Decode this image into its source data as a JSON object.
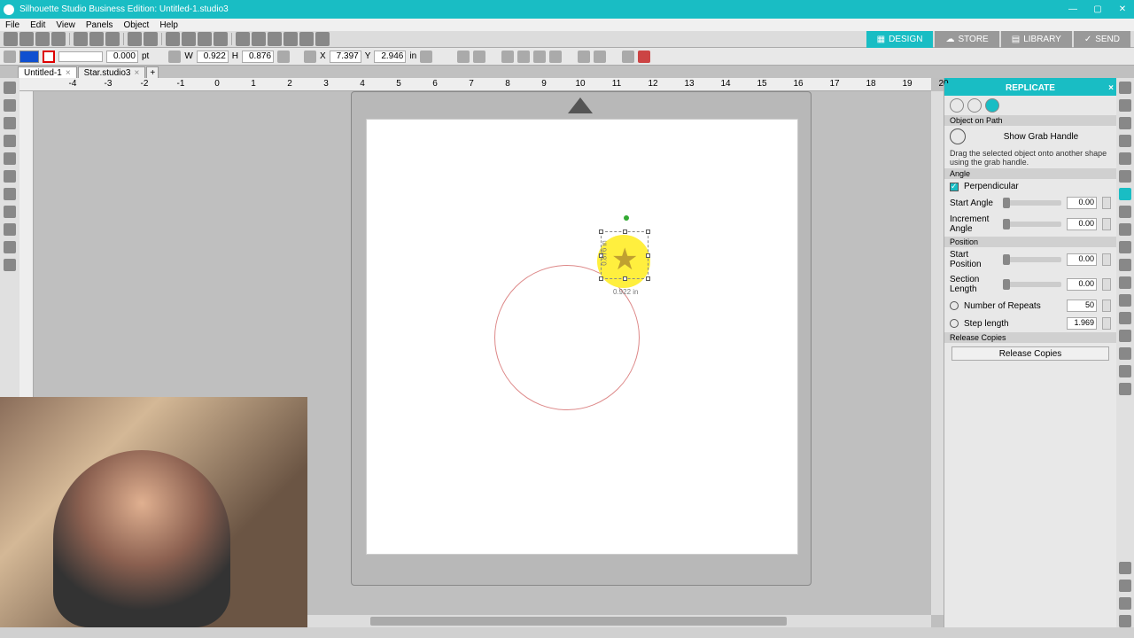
{
  "title": "Silhouette Studio Business Edition: Untitled-1.studio3",
  "menu": [
    "File",
    "Edit",
    "View",
    "Panels",
    "Object",
    "Help"
  ],
  "rightButtons": {
    "design": "DESIGN",
    "store": "STORE",
    "library": "LIBRARY",
    "send": "SEND"
  },
  "tb2": {
    "stroke": "0.000",
    "pt": "pt",
    "w": "W",
    "wv": "0.922",
    "h": "H",
    "hv": "0.876",
    "x": "X",
    "xv": "7.397",
    "y": "Y",
    "yv": "2.946",
    "unit": "in"
  },
  "tabs": [
    {
      "name": "Untitled-1"
    },
    {
      "name": "Star.studio3"
    }
  ],
  "rulerMarks": [
    -4,
    -3,
    -2,
    -1,
    0,
    1,
    2,
    3,
    4,
    5,
    6,
    7,
    8,
    9,
    10,
    11,
    12,
    13,
    14,
    15
  ],
  "dims": {
    "w": "0.922 in",
    "h": "0.876 in"
  },
  "panel": {
    "title": "REPLICATE",
    "objectPath": "Object on Path",
    "showGrab": "Show Grab Handle",
    "desc": "Drag the selected object onto another shape using the grab handle.",
    "angle": "Angle",
    "perp": "Perpendicular",
    "startAngle": "Start Angle",
    "startAngleV": "0.00",
    "incAngle": "Increment\nAngle",
    "incAngleV": "0.00",
    "position": "Position",
    "startPos": "Start Position",
    "startPosV": "0.00",
    "secLen": "Section\nLength",
    "secLenV": "0.00",
    "numRep": "Number of Repeats",
    "numRepV": "50",
    "stepLen": "Step length",
    "stepLenV": "1.969",
    "relCopies": "Release Copies",
    "relBtn": "Release Copies"
  }
}
